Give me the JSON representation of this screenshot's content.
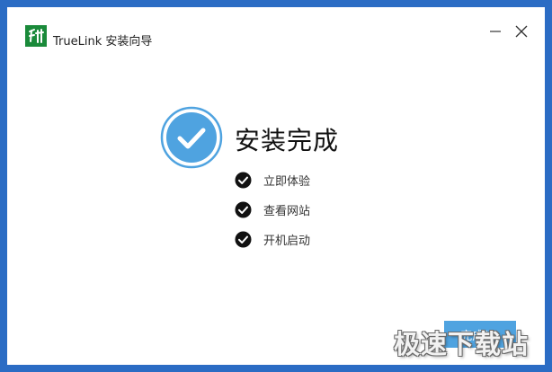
{
  "window": {
    "app_title": "TrueLink 安装向导"
  },
  "titlebar": {
    "logo_icon": "truelink-logo-icon",
    "minimize_icon": "minimize-icon",
    "close_icon": "close-icon"
  },
  "main": {
    "status_icon": "check-circle-icon",
    "title": "安装完成",
    "options": [
      {
        "label": "立即体验",
        "checked": true
      },
      {
        "label": "查看网站",
        "checked": true
      },
      {
        "label": "开机启动",
        "checked": true
      }
    ]
  },
  "footer": {
    "finish_label": "完成(F)"
  },
  "watermark": "极速下载站",
  "colors": {
    "accent": "#4fa3e0",
    "logo_green": "#1a8a3a",
    "frame_blue": "#2b6cc4"
  }
}
